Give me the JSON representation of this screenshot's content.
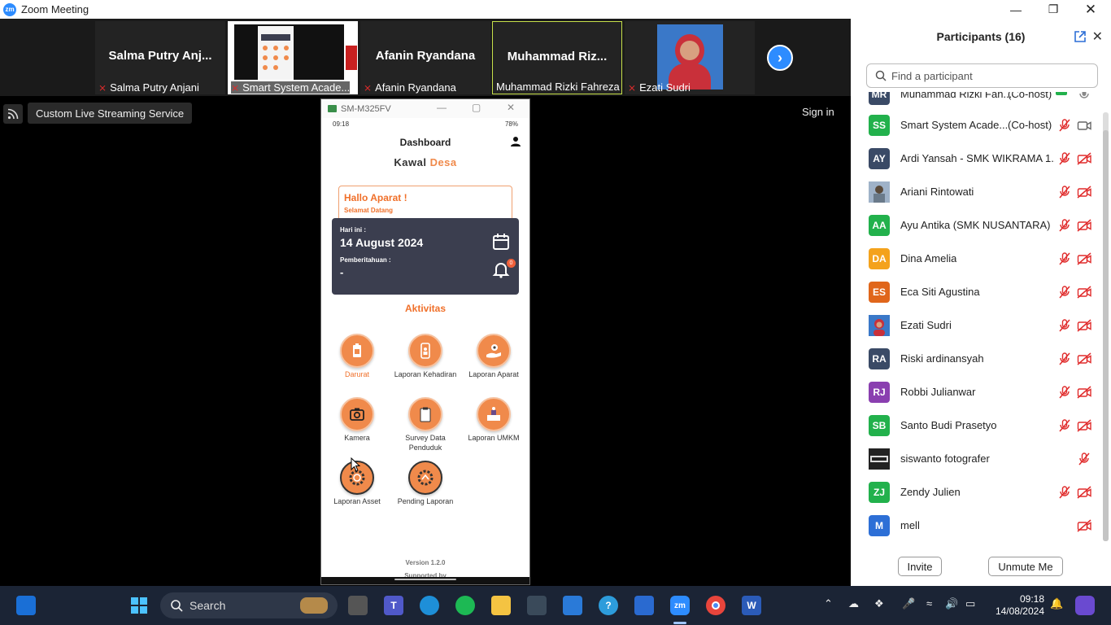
{
  "window": {
    "title": "Zoom Meeting"
  },
  "gallery": {
    "tiles": [
      {
        "big_name": "Salma  Putry  Anj...",
        "tag": "Salma Putry Anjani",
        "muted": true
      },
      {
        "big_name": "",
        "tag": "Smart System Acade...",
        "muted": true
      },
      {
        "big_name": "Afanin Ryandana",
        "tag": "Afanin Ryandana",
        "muted": true
      },
      {
        "big_name": "Muhammad  Riz...",
        "tag": "Muhammad Rizki Fahreza",
        "muted": false
      },
      {
        "big_name": "",
        "tag": "Ezati Sudri",
        "muted": true
      }
    ]
  },
  "stage": {
    "live_label": "Custom Live Streaming Service",
    "sign_in": "Sign in"
  },
  "phone": {
    "window_title": "SM-M325FV",
    "status_time": "09:18",
    "status_battery": "78%",
    "header_title": "Dashboard",
    "brand_part1": "Kawal",
    "brand_part2": "Desa",
    "greeting": "Hallo Aparat !",
    "greeting_sub": "Selamat Datang",
    "today_label": "Hari ini :",
    "today_date": "14 August 2024",
    "notif_label": "Pemberitahuan :",
    "notif_value": "-",
    "notif_badge": "0",
    "section_title": "Aktivitas",
    "activities": [
      "Darurat",
      "Laporan Kehadiran",
      "Laporan Aparat",
      "Kamera",
      "Survey Data Penduduk",
      "Laporan UMKM",
      "Laporan Asset",
      "Pending Laporan"
    ],
    "version": "Version 1.2.0",
    "supported_by": "Supported by"
  },
  "participants": {
    "title": "Participants (16)",
    "search_placeholder": "Find a participant",
    "rows": [
      {
        "initials": "MR",
        "name": "Muhammad Rizki Fah...",
        "role": "(Co-host)",
        "color": "#3a4a66"
      },
      {
        "initials": "SS",
        "name": "Smart System Acade...",
        "role": "(Co-host)",
        "color": "#22b14c"
      },
      {
        "initials": "AY",
        "name": "Ardi Yansah - SMK WIKRAMA 1...",
        "role": "",
        "color": "#3a4a66"
      },
      {
        "initials": "",
        "name": "Ariani Rintowati",
        "role": "",
        "color": "#8a9bb0"
      },
      {
        "initials": "AA",
        "name": "Ayu Antika (SMK NUSANTARA)",
        "role": "",
        "color": "#22b14c"
      },
      {
        "initials": "DA",
        "name": "Dina Amelia",
        "role": "",
        "color": "#f4a21c"
      },
      {
        "initials": "ES",
        "name": "Eca Siti Agustina",
        "role": "",
        "color": "#e0661b"
      },
      {
        "initials": "",
        "name": "Ezati Sudri",
        "role": "",
        "color": "#c9524a"
      },
      {
        "initials": "RA",
        "name": "Riski ardinansyah",
        "role": "",
        "color": "#3a4a66"
      },
      {
        "initials": "RJ",
        "name": "Robbi Julianwar",
        "role": "",
        "color": "#8a3fb0"
      },
      {
        "initials": "SB",
        "name": "Santo Budi Prasetyo",
        "role": "",
        "color": "#22b14c"
      },
      {
        "initials": "",
        "name": "siswanto fotografer",
        "role": "",
        "color": "#444444"
      },
      {
        "initials": "ZJ",
        "name": "Zendy Julien",
        "role": "",
        "color": "#22b14c"
      },
      {
        "initials": "M",
        "name": "mell",
        "role": "",
        "color": "#2d6fd6"
      }
    ],
    "invite_label": "Invite",
    "unmute_label": "Unmute Me"
  },
  "taskbar": {
    "search_label": "Search",
    "time": "09:18",
    "date": "14/08/2024"
  },
  "colors": {
    "accent_orange": "#f08a4b",
    "zoom_blue": "#2d8cff",
    "muted_red": "#e02b2b"
  }
}
